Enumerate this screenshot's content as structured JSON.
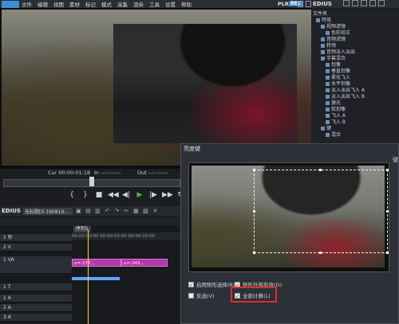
{
  "app": {
    "name": "EDIUS",
    "plr": "PLR",
    "rec": "REC"
  },
  "menu": [
    "文件",
    "编辑",
    "视图",
    "素材",
    "标记",
    "模式",
    "采集",
    "渲染",
    "工具",
    "设置",
    "帮助"
  ],
  "player": {
    "timecode": "Cur 00:00:01:18",
    "in": "In --:--:--:--",
    "out": "Out --:--:--:--"
  },
  "timeline": {
    "title": "EDIUS",
    "project": "无标题[0-160819-...",
    "tab": "序列1",
    "ruler": "00:00:00:00   00:00:05:00   00:00:10:00",
    "tracks": [
      {
        "label": "1 秒"
      },
      {
        "label": "2 V"
      },
      {
        "label": "1 VA"
      },
      {
        "label": "1 T"
      },
      {
        "label": "1 A"
      },
      {
        "label": "2 A"
      },
      {
        "label": "3 A"
      }
    ],
    "clips": [
      {
        "label": "u=-177..."
      },
      {
        "label": "u=-242..."
      }
    ]
  },
  "right_panel": {
    "title": "EDIUS",
    "header": "文件夹",
    "tree": [
      "特效",
      "视频滤镜",
      "色彩校正",
      "音频滤镜",
      "转场",
      "音频淡入淡出",
      "字幕混合",
      "划像",
      "垂直划像",
      "柔化飞入",
      "水平划像",
      "淡入淡出飞入 A",
      "淡入淡出飞入 B",
      "激光",
      "软划像",
      "飞入 A",
      "飞入 B",
      "键",
      "混合"
    ]
  },
  "dialog": {
    "title": "亮度键",
    "right_label": "键",
    "options": [
      {
        "label": "启用矩形选择(R)",
        "checked": true
      },
      {
        "label": "矩形外部有效(O)",
        "checked": true
      },
      {
        "label": "反选(V)",
        "checked": false
      },
      {
        "label": "全部计算(L)",
        "checked": true
      }
    ]
  },
  "colors": {
    "accent": "#3d8fd6",
    "clip": "#b23aa8",
    "highlight": "#e02b2b",
    "play": "#4fb34a"
  }
}
